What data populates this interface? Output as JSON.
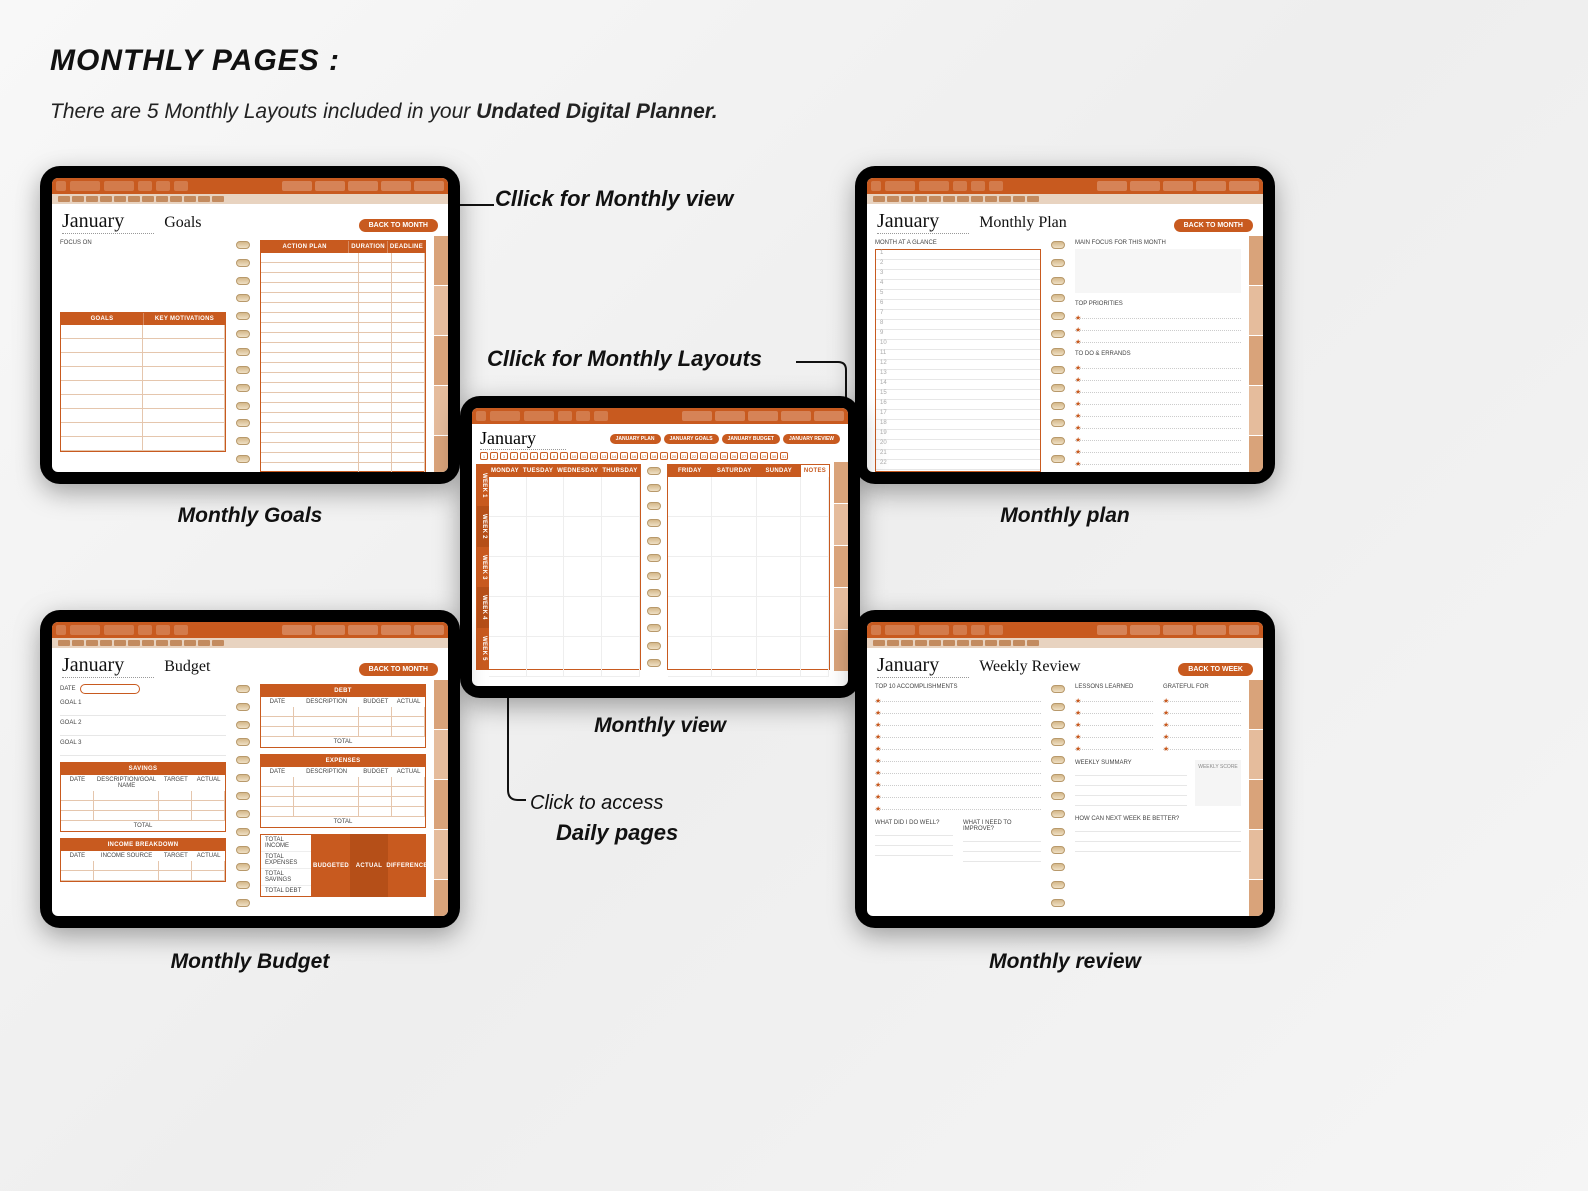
{
  "header": {
    "title": "MONTHLY PAGES :",
    "subtitle_a": "There are 5 Monthly Layouts included in your ",
    "subtitle_b": "Undated Digital Planner."
  },
  "annot": {
    "monthly_view": "Cllick for Monthly view",
    "monthly_layouts": "Cllick for Monthly Layouts",
    "daily_a": "Click to access",
    "daily_b": "Daily pages"
  },
  "captions": {
    "goals": "Monthly Goals",
    "plan": "Monthly plan",
    "view": "Monthly view",
    "budget": "Monthly Budget",
    "review": "Monthly review"
  },
  "planner": {
    "month": "January",
    "back_to_month": "BACK TO MONTH",
    "back_to_week": "BACK TO WEEK",
    "nav": {
      "calendar": "CALENDAR",
      "year": "YEAR",
      "fitness": "FITNESS",
      "finance": "FINANCE",
      "wellness": "WELLNESS",
      "productivity": "PRODUCTIVITY",
      "lifestyle": "LIFESTYLE"
    },
    "month_tabs": [
      "JAN",
      "FEB",
      "MAR",
      "APR",
      "MAY",
      "JUN",
      "JUL",
      "AUG",
      "SEP",
      "OCT",
      "NOV",
      "DEC"
    ],
    "goals": {
      "title": "Goals",
      "focus_on": "FOCUS ON",
      "goals_hdr": "GOALS",
      "motivation_hdr": "KEY MOTIVATIONS",
      "action_plan": "ACTION PLAN",
      "duration": "DURATION",
      "deadline": "DEADLINE"
    },
    "plan": {
      "title": "Monthly Plan",
      "glance": "MONTH AT A GLANCE",
      "focus": "MAIN FOCUS FOR THIS MONTH",
      "priorities": "TOP PRIORITIES",
      "todo": "TO DO & ERRANDS"
    },
    "view": {
      "layout_tabs": [
        "JANUARY PLAN",
        "JANUARY GOALS",
        "JANUARY BUDGET",
        "JANUARY REVIEW"
      ],
      "days_left": [
        "MONDAY",
        "TUESDAY",
        "WEDNESDAY",
        "THURSDAY"
      ],
      "days_right": [
        "FRIDAY",
        "SATURDAY",
        "SUNDAY"
      ],
      "notes": "NOTES",
      "weeks": [
        "WEEK 1",
        "WEEK 2",
        "WEEK 3",
        "WEEK 4",
        "WEEK 5"
      ]
    },
    "budget": {
      "title": "Budget",
      "date": "DATE",
      "goal": "GOAL",
      "savings": "SAVINGS",
      "income": "INCOME BREAKDOWN",
      "debt": "DEBT",
      "expenses": "EXPENSES",
      "desc": "DESCRIPTION",
      "budget_col": "BUDGET",
      "actual": "ACTUAL",
      "target": "TARGET",
      "income_src": "INCOME SOURCE",
      "desc_goal": "DESCRIPTION/GOAL NAME",
      "total": "TOTAL",
      "budgeted": "BUDGETED",
      "difference": "DIFFERENCE",
      "total_income": "TOTAL INCOME",
      "total_expenses": "TOTAL EXPENSES",
      "total_savings": "TOTAL SAVINGS",
      "total_debt": "TOTAL DEBT"
    },
    "review": {
      "title": "Weekly Review",
      "accomplishments": "TOP 10 ACCOMPLISHMENTS",
      "lessons": "LESSONS LEARNED",
      "grateful": "GRATEFUL FOR",
      "summary": "WEEKLY SUMMARY",
      "score": "WEEKLY SCORE",
      "did_well": "WHAT DID I DO WELL?",
      "improve": "WHAT I NEED TO IMPROVE?",
      "better": "HOW CAN NEXT WEEK BE BETTER?"
    }
  }
}
